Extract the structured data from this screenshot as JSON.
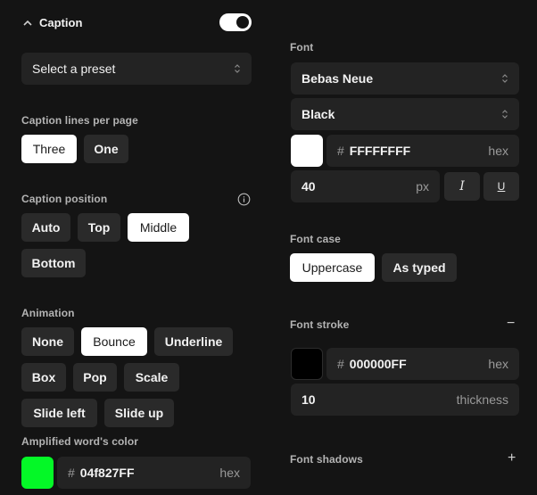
{
  "caption": {
    "title": "Caption",
    "toggle_on": true,
    "preset_placeholder": "Select a preset",
    "lines_label": "Caption lines per page",
    "lines_options": [
      "Three",
      "One"
    ],
    "lines_selected": "Three",
    "position_label": "Caption position",
    "position_options": [
      "Auto",
      "Top",
      "Middle",
      "Bottom"
    ],
    "position_selected": "Middle",
    "animation_label": "Animation",
    "animation_options": [
      "None",
      "Bounce",
      "Underline",
      "Box",
      "Pop",
      "Scale",
      "Slide left",
      "Slide up"
    ],
    "animation_selected": "Bounce",
    "amplified_label": "Amplified word's color",
    "amplified_color_hex": "04f827FF",
    "amplified_color": "#04f827",
    "hex_suffix": "hex",
    "hash": "#"
  },
  "font": {
    "label": "Font",
    "family": "Bebas Neue",
    "weight": "Black",
    "color_hex": "FFFFFFFF",
    "color": "#ffffff",
    "size": "40",
    "size_unit": "px",
    "italic_glyph": "I",
    "underline_glyph": "U",
    "case_label": "Font case",
    "case_options": [
      "Uppercase",
      "As typed"
    ],
    "case_selected": "Uppercase",
    "stroke_label": "Font stroke",
    "stroke_color_hex": "000000FF",
    "stroke_color": "#000000",
    "stroke_thickness": "10",
    "thickness_suffix": "thickness",
    "shadows_label": "Font shadows",
    "minus_glyph": "−",
    "plus_glyph": "+"
  }
}
